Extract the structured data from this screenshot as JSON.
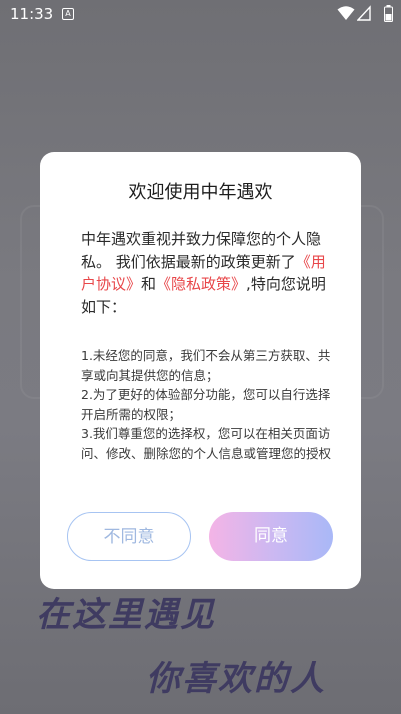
{
  "status_bar": {
    "time": "11:33",
    "notification_badge": "A"
  },
  "dialog": {
    "title": "欢迎使用中年遇欢",
    "intro_text_1": "中年遇欢重视并致力保障您的个人隐私。 我们依据最新的政策更新了",
    "user_agreement_link": "《用户协议》",
    "and_text": "和",
    "privacy_policy_link": "《隐私政策》",
    "intro_text_2": ",特向您说明如下：",
    "details": [
      "1.未经您的同意，我们不会从第三方获取、共享或向其提供您的信息；",
      "2.为了更好的体验部分功能，您可以自行选择开启所需的权限；",
      "3.我们尊重您的选择权，您可以在相关页面访问、修改、删除您的个人信息或管理您的授权"
    ],
    "disagree_label": "不同意",
    "agree_label": "同意"
  },
  "slogan": {
    "line1": "在这里遇见",
    "line2": "你喜欢的人"
  },
  "colors": {
    "link": "#e8474a",
    "agree_gradient_start": "#f4b4e6",
    "agree_gradient_end": "#a9b8f7",
    "disagree_border": "#a7c4f2"
  }
}
